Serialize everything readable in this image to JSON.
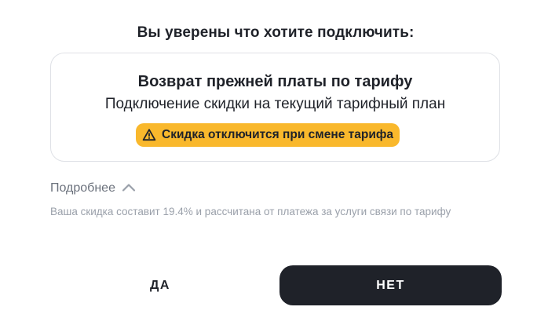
{
  "dialog": {
    "title": "Вы уверены что хотите подключить:"
  },
  "offer": {
    "title": "Возврат прежней платы по тарифу",
    "subtitle": "Подключение скидки на текущий тарифный план",
    "warning": {
      "icon": "warning-triangle-icon",
      "text": "Скидка отключится при смене тарифа",
      "color": "#f9b82c"
    }
  },
  "details": {
    "label": "Подробнее",
    "icon": "chevron-up-icon",
    "expanded": true,
    "text": "Ваша скидка составит 19.4% и рассчитана от платежа за услуги связи по тарифу"
  },
  "buttons": {
    "yes_label": "ДА",
    "no_label": "НЕТ",
    "primary_color": "#1f2229"
  }
}
